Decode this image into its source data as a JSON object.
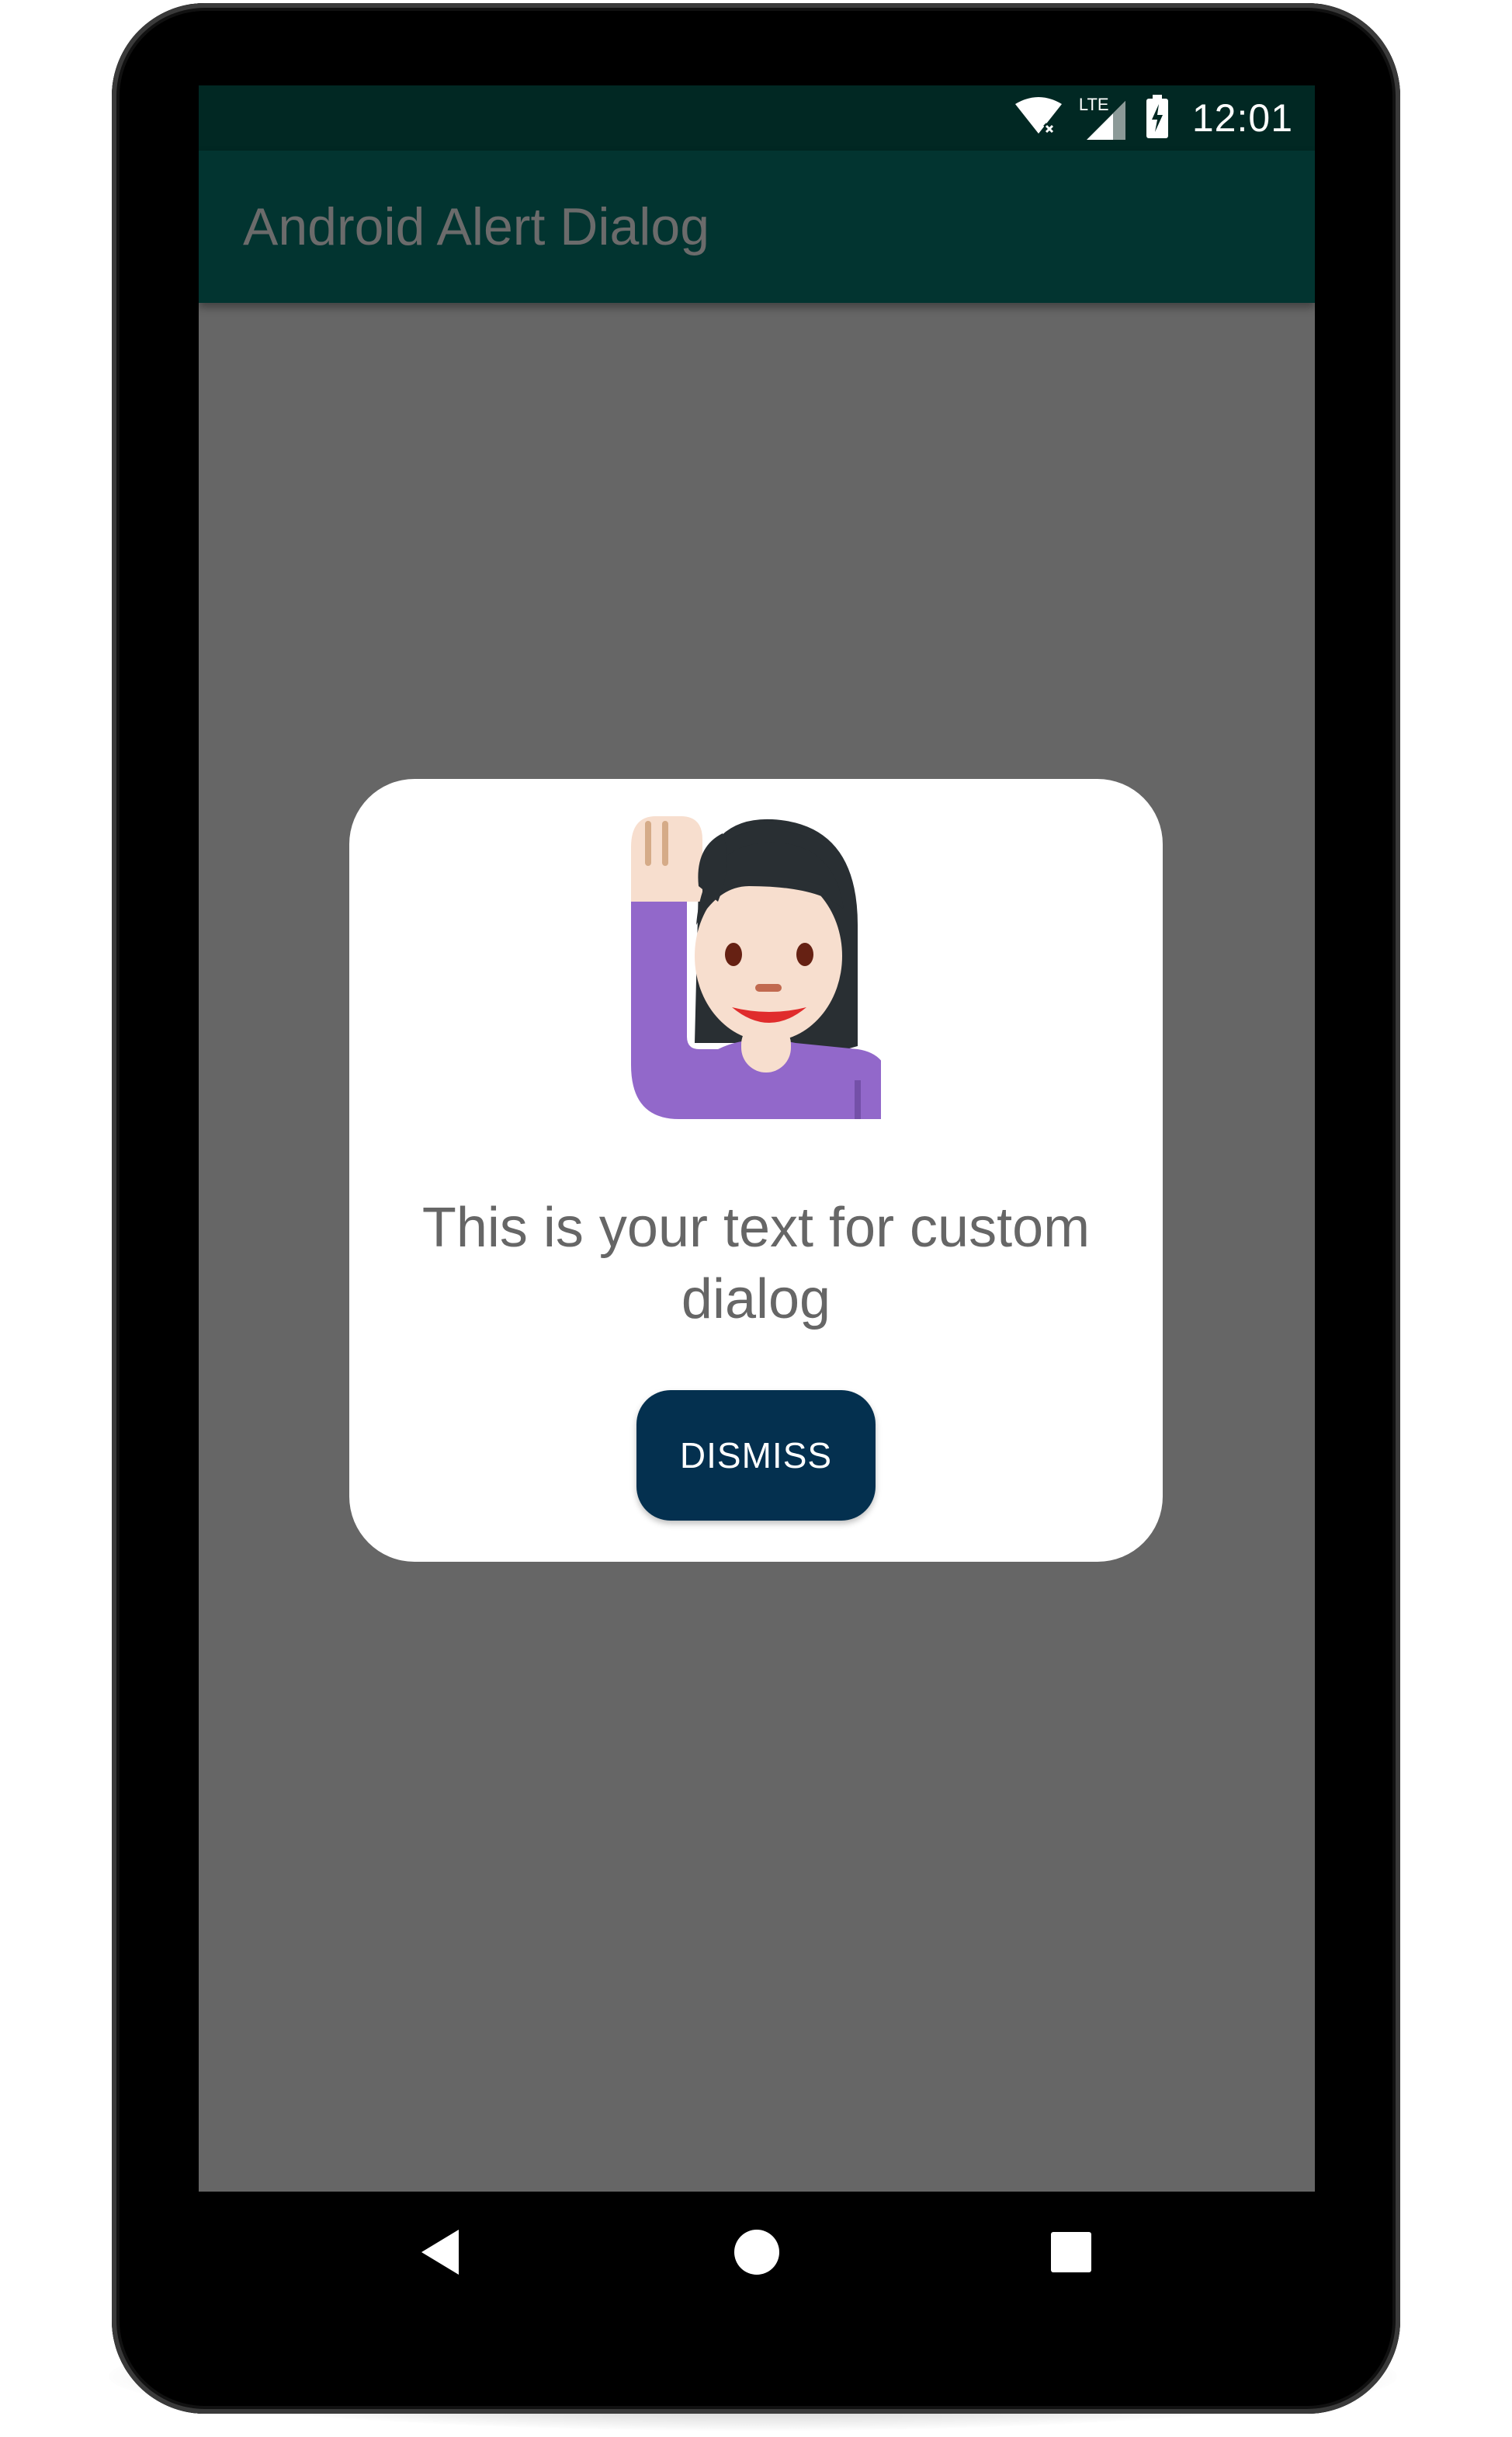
{
  "status_bar": {
    "time": "12:01",
    "network_label": "LTE",
    "icons": [
      "wifi-icon",
      "cell-signal-icon",
      "battery-charging-icon"
    ]
  },
  "app_bar": {
    "title": "Android Alert Dialog"
  },
  "dialog": {
    "image": "woman-raising-hand-emoji",
    "message": "This is your text for custom dialog",
    "dismiss_label": "DISMISS"
  },
  "nav_bar": {
    "icons": [
      "back-triangle-icon",
      "home-circle-icon",
      "recents-square-icon"
    ]
  },
  "colors": {
    "status_bar": "#012823",
    "app_bar": "#023430",
    "scrim": "#666666",
    "dialog_background": "#ffffff",
    "button": "#04304f",
    "message_text": "#666666"
  }
}
